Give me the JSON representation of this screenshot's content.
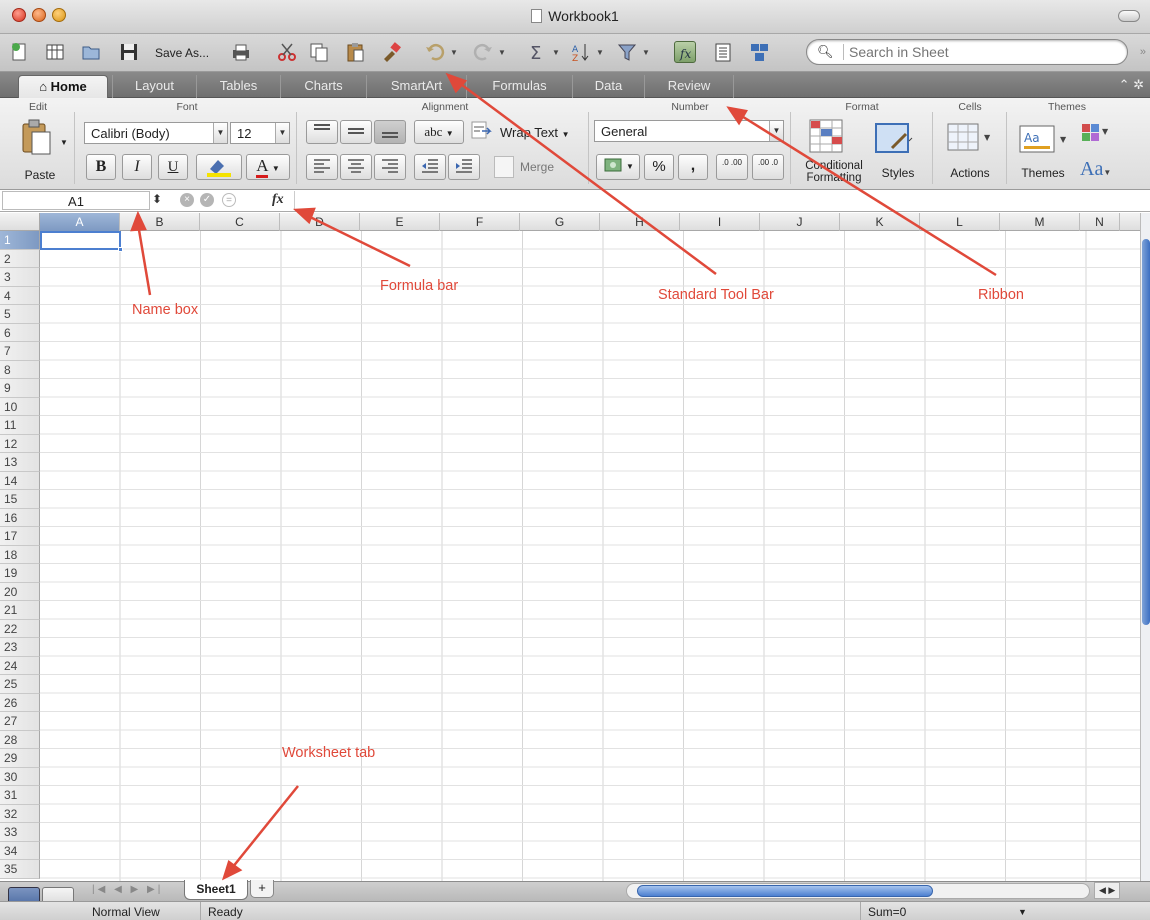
{
  "window": {
    "title": "Workbook1"
  },
  "toolbar": {
    "save_as_label": "Save As...",
    "search_placeholder": "Search in Sheet",
    "icons": [
      "new-workbook-icon",
      "templates-icon",
      "open-icon",
      "save-icon",
      "print-icon",
      "cut-icon",
      "copy-icon",
      "paste-icon",
      "format-painter-icon",
      "undo-icon",
      "redo-icon",
      "autosum-icon",
      "sort-icon",
      "filter-icon",
      "formula-builder-icon",
      "toolbox-icon",
      "gallery-icon",
      "search-icon"
    ]
  },
  "ribbon_tabs": [
    "Home",
    "Layout",
    "Tables",
    "Charts",
    "SmartArt",
    "Formulas",
    "Data",
    "Review"
  ],
  "ribbon": {
    "groups": {
      "edit": "Edit",
      "font": "Font",
      "alignment": "Alignment",
      "number": "Number",
      "format": "Format",
      "cells": "Cells",
      "themes": "Themes"
    },
    "paste_label": "Paste",
    "font_name": "Calibri (Body)",
    "font_size": "12",
    "bold": "B",
    "italic": "I",
    "underline": "U",
    "font_color_glyph": "A",
    "abc_label": "abc",
    "wrap_text_label": "Wrap Text",
    "merge_label": "Merge",
    "number_format": "General",
    "percent": "%",
    "comma": ",",
    "inc_decimal": ".0 .00",
    "dec_decimal": ".00 .0",
    "conditional_formatting": "Conditional Formatting",
    "styles": "Styles",
    "actions": "Actions",
    "themes": "Themes",
    "aa_label": "Aa"
  },
  "formula_bar": {
    "name_box": "A1",
    "fx": "fx",
    "value": ""
  },
  "grid": {
    "columns": [
      "A",
      "B",
      "C",
      "D",
      "E",
      "F",
      "G",
      "H",
      "I",
      "J",
      "K",
      "L",
      "M",
      "N"
    ],
    "rows": [
      "1",
      "2",
      "3",
      "4",
      "5",
      "6",
      "7",
      "8",
      "9",
      "10",
      "11",
      "12",
      "13",
      "14",
      "15",
      "16",
      "17",
      "18",
      "19",
      "20",
      "21",
      "22",
      "23",
      "24",
      "25",
      "26",
      "27",
      "28",
      "29",
      "30",
      "31",
      "32",
      "33",
      "34",
      "35"
    ],
    "selected_cell": "A1"
  },
  "sheets": {
    "active": "Sheet1",
    "add": "+"
  },
  "statusbar": {
    "view": "Normal View",
    "status": "Ready",
    "sum": "Sum=0"
  },
  "annotations": {
    "name_box": "Name box",
    "formula_bar": "Formula bar",
    "standard_toolbar": "Standard Tool Bar",
    "ribbon": "Ribbon",
    "worksheet_tab": "Worksheet tab"
  },
  "colors": {
    "annotation": "#e0493a",
    "selection": "#4c7fd0",
    "ribbon_tab_bg": "#7c7c7c"
  }
}
